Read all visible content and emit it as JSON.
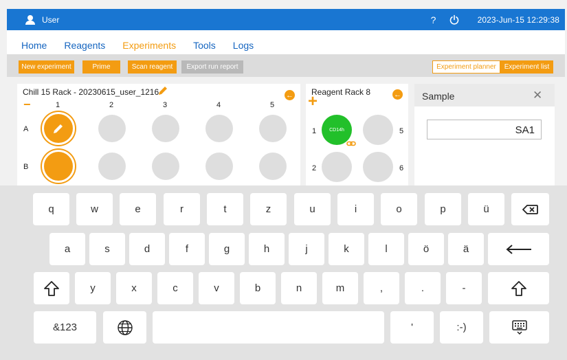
{
  "topbar": {
    "user": "User",
    "help": "?",
    "datetime": "2023-Jun-15  12:29:38"
  },
  "nav": [
    "Home",
    "Reagents",
    "Experiments",
    "Tools",
    "Logs"
  ],
  "nav_active": "Experiments",
  "actions": {
    "new_experiment": "New experiment",
    "prime": "Prime",
    "scan_reagent": "Scan reagent",
    "export_run_report": "Export run report",
    "experiment_planner": "Experiment planner",
    "experiment_list": "Experiment list"
  },
  "rack": {
    "title": "Chill 15 Rack - 20230615_user_1216",
    "minus": "−",
    "columns": [
      "1",
      "2",
      "3",
      "4",
      "5"
    ],
    "rows": [
      "A",
      "B"
    ]
  },
  "reagent_rack": {
    "title": "Reagent Rack 8",
    "plus": "+",
    "labels": [
      "1",
      "5",
      "2",
      "6"
    ],
    "tube_label": "CD14h"
  },
  "sample": {
    "title": "Sample",
    "close": "✕",
    "value": "SA1"
  },
  "keyboard": {
    "row1": [
      "q",
      "w",
      "e",
      "r",
      "t",
      "z",
      "u",
      "i",
      "o",
      "p",
      "ü"
    ],
    "row2": [
      "a",
      "s",
      "d",
      "f",
      "g",
      "h",
      "j",
      "k",
      "l",
      "ö",
      "ä"
    ],
    "row3": [
      "y",
      "x",
      "c",
      "v",
      "b",
      "n",
      "m",
      ",",
      ".",
      "-"
    ],
    "symbols": "&123",
    "apostrophe": "'",
    "smiley": ":-)"
  },
  "colors": {
    "accent": "#f39c12",
    "primary": "#1976d2",
    "tube": "#22c02a"
  }
}
